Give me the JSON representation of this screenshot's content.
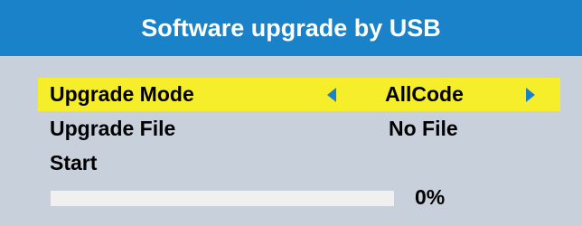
{
  "dialog": {
    "title": "Software upgrade by USB"
  },
  "menu": {
    "items": [
      {
        "label": "Upgrade Mode",
        "value": "AllCode",
        "selected": true
      },
      {
        "label": "Upgrade File",
        "value": "No File",
        "selected": false
      },
      {
        "label": "Start",
        "value": "",
        "selected": false
      }
    ]
  },
  "progress": {
    "percent": 0,
    "text": "0%"
  },
  "colors": {
    "title_bg": "#1a82c8",
    "panel_bg": "#c8d0dc",
    "selected_bg": "#f6ee2a",
    "arrow": "#1a82c8"
  },
  "icons": {
    "left_arrow": "triangle-left-icon",
    "right_arrow": "triangle-right-icon"
  }
}
